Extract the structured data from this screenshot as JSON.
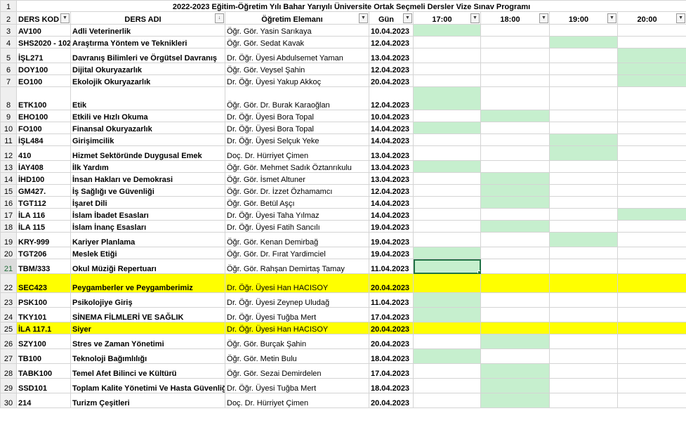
{
  "title": "2022-2023 Eğitim-Öğretim Yılı Bahar Yarıyılı Üniversite Ortak Seçmeli Dersler Vize Sınav Programı",
  "headers": {
    "code": "DERS KOD",
    "name": "DERS ADI",
    "teacher": "Öğretim Elemanı",
    "day": "Gün",
    "t1700": "17:00",
    "t1800": "18:00",
    "t1900": "19:00",
    "t2000": "20:00"
  },
  "filter_icons": {
    "code": "▼",
    "name": "↓",
    "teacher": "▼",
    "day": "▼",
    "t1700": "▼",
    "t1800": "▼",
    "t1900": "▼",
    "t2000": "▼"
  },
  "row_numbers": [
    "1",
    "2",
    "3",
    "4",
    "5",
    "6",
    "7",
    "8",
    "9",
    "10",
    "11",
    "12",
    "13",
    "14",
    "15",
    "16",
    "17",
    "18",
    "19",
    "20",
    "21",
    "22",
    "23",
    "24",
    "25",
    "26",
    "27",
    "28",
    "29",
    "30"
  ],
  "rows": [
    {
      "code": "AV100",
      "name": "Adli Veterinerlik",
      "teacher": "Öğr. Gör. Yasin Sarıkaya",
      "date": "10.04.2023",
      "slot": "17:00"
    },
    {
      "code": "SHS2020 - 102",
      "name": "Araştırma Yöntem ve Teknikleri",
      "teacher": "Öğr. Gör. Sedat Kavak",
      "date": "12.04.2023",
      "slot": "19:00"
    },
    {
      "code": "İŞL271",
      "name": "Davranış Bilimleri ve Örgütsel Davranış",
      "teacher": "Dr. Öğr. Üyesi Abdulsemet Yaman",
      "date": "13.04.2023",
      "slot": "20:00"
    },
    {
      "code": "DOY100",
      "name": "Dijital Okuryazarlık",
      "teacher": "Öğr. Gör. Veysel Şahin",
      "date": "12.04.2023",
      "slot": "20:00"
    },
    {
      "code": "EO100",
      "name": "Ekolojik Okuryazarlık",
      "teacher": "Dr. Öğr. Üyesi Yakup Akkoç",
      "date": "20.04.2023",
      "slot": "20:00"
    },
    {
      "code": "ETK100",
      "name": "Etik",
      "teacher": "Öğr. Gör. Dr. Burak Karaoğlan",
      "date": "12.04.2023",
      "slot": "17:00"
    },
    {
      "code": "EHO100",
      "name": "Etkili ve Hızlı Okuma",
      "teacher": "Dr. Öğr. Üyesi Bora Topal",
      "date": "10.04.2023",
      "slot": "18:00"
    },
    {
      "code": "FO100",
      "name": "Finansal Okuryazarlık",
      "teacher": "Dr. Öğr. Üyesi Bora Topal",
      "date": "14.04.2023",
      "slot": "17:00"
    },
    {
      "code": "İŞL484",
      "name": "Girişimcilik",
      "teacher": "Dr. Öğr. Üyesi Selçuk Yeke",
      "date": "14.04.2023",
      "slot": "19:00"
    },
    {
      "code": "410",
      "name": "Hizmet Sektöründe Duygusal Emek",
      "teacher": "Doç. Dr. Hürriyet Çimen",
      "date": "13.04.2023",
      "slot": "19:00"
    },
    {
      "code": "İAY408",
      "name": "İlk Yardım",
      "teacher": "Öğr. Gör. Mehmet Sadık Öztanrıkulu",
      "date": "13.04.2023",
      "slot": "17:00"
    },
    {
      "code": "İHD100",
      "name": "İnsan Hakları ve Demokrasi",
      "teacher": "Öğr. Gör. İsmet Altuner",
      "date": "13.04.2023",
      "slot": "18:00"
    },
    {
      "code": "GM427.",
      "name": "İş Sağlığı ve Güvenliği",
      "teacher": "Öğr. Gör. Dr. İzzet Özhamamcı",
      "date": "12.04.2023",
      "slot": "18:00"
    },
    {
      "code": "TGT112",
      "name": "İşaret Dili",
      "teacher": "Öğr. Gör. Betül Aşçı",
      "date": "14.04.2023",
      "slot": "18:00"
    },
    {
      "code": "İLA 116",
      "name": "İslam İbadet Esasları",
      "teacher": "Dr. Öğr. Üyesi Taha Yılmaz",
      "date": "14.04.2023",
      "slot": "20:00"
    },
    {
      "code": "İLA 115",
      "name": "İslam İnanç Esasları",
      "teacher": "Dr. Öğr. Üyesi Fatih Sancılı",
      "date": "19.04.2023",
      "slot": "18:00"
    },
    {
      "code": "KRY-999",
      "name": "Kariyer Planlama",
      "teacher": "Öğr. Gör. Kenan Demirbağ",
      "date": "19.04.2023",
      "slot": "19:00"
    },
    {
      "code": "TGT206",
      "name": "Meslek Etiği",
      "teacher": "Öğr. Gör. Dr. Fırat Yardimciel",
      "date": "19.04.2023",
      "slot": "17:00"
    },
    {
      "code": "TBM/333",
      "name": "Okul Müziği Repertuarı",
      "teacher": "Öğr. Gör. Rahşan Demirtaş Tamay",
      "date": "11.04.2023",
      "slot": "17:00"
    },
    {
      "code": "SEC423",
      "name": "Peygamberler ve Peygamberimiz",
      "teacher": "Dr. Öğr. Üyesi Han HACISOY",
      "date": "20.04.2023",
      "slot": ""
    },
    {
      "code": "PSK100",
      "name": "Psikolojiye Giriş",
      "teacher": "Dr. Öğr. Üyesi Zeynep Uludağ",
      "date": "11.04.2023",
      "slot": "17:00"
    },
    {
      "code": "TKY101",
      "name": "SİNEMA FİLMLERİ VE SAĞLIK",
      "teacher": "Dr. Öğr. Üyesi Tuğba Mert",
      "date": "17.04.2023",
      "slot": "17:00"
    },
    {
      "code": "İLA 117.1",
      "name": "Siyer",
      "teacher": "Dr. Öğr. Üyesi Han HACISOY",
      "date": "20.04.2023",
      "slot": ""
    },
    {
      "code": "SZY100",
      "name": "Stres ve Zaman Yönetimi",
      "teacher": "Öğr. Gör. Burçak Şahin",
      "date": "20.04.2023",
      "slot": "18:00"
    },
    {
      "code": "TB100",
      "name": "Teknoloji Bağımlılığı",
      "teacher": "Öğr. Gör. Metin Bulu",
      "date": "18.04.2023",
      "slot": "17:00"
    },
    {
      "code": "TABK100",
      "name": "Temel Afet Bilinci ve Kültürü",
      "teacher": "Öğr. Gör. Sezai Demirdelen",
      "date": "17.04.2023",
      "slot": "18:00"
    },
    {
      "code": "SSD101",
      "name": "Toplam Kalite Yönetimi Ve Hasta Güvenliği",
      "teacher": "Dr. Öğr. Üyesi Tuğba Mert",
      "date": "18.04.2023",
      "slot": "18:00"
    },
    {
      "code": "214",
      "name": "Turizm Çeşitleri",
      "teacher": "Doç. Dr. Hürriyet Çimen",
      "date": "20.04.2023",
      "slot": "18:00"
    }
  ],
  "highlight_rows": [
    "SEC423",
    "İLA 117.1"
  ],
  "colors": {
    "green_fill": "#c6efce",
    "yellow_fill": "#ffff00",
    "date_text": "#c00000",
    "selection": "#217346"
  }
}
